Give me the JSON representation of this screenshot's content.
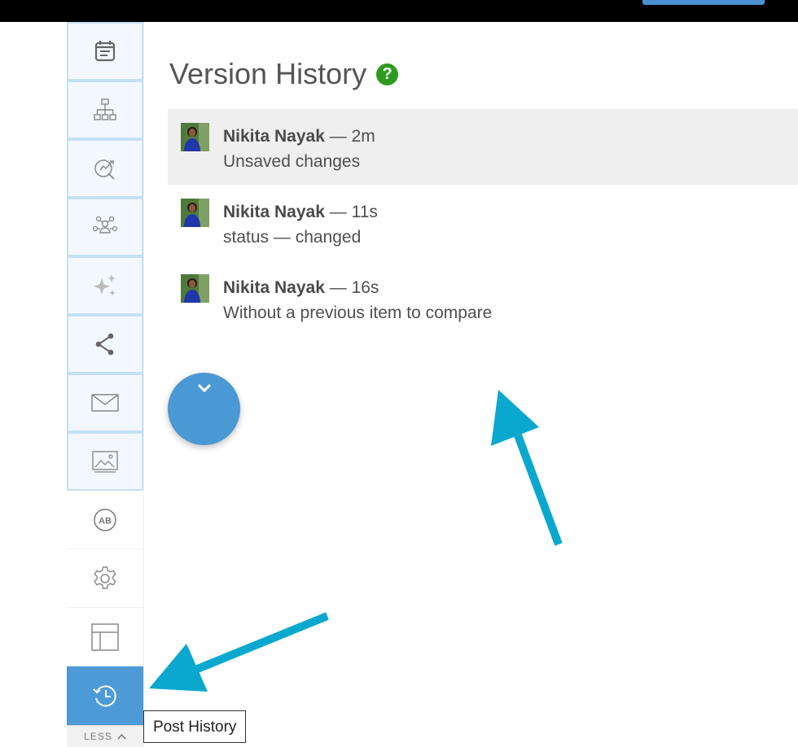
{
  "page": {
    "title": "Version History",
    "help_symbol": "?"
  },
  "versions": [
    {
      "author": "Nikita Nayak",
      "age": "2m",
      "description": "Unsaved changes",
      "selected": true
    },
    {
      "author": "Nikita Nayak",
      "age": "11s",
      "description": "status — changed",
      "selected": false
    },
    {
      "author": "Nikita Nayak",
      "age": "16s",
      "description": "Without a previous item to compare",
      "selected": false
    }
  ],
  "sidebar": {
    "items": [
      {
        "icon": "calendar-icon"
      },
      {
        "icon": "sitemap-icon"
      },
      {
        "icon": "target-icon"
      },
      {
        "icon": "people-network-icon"
      },
      {
        "icon": "sparkle-icon"
      },
      {
        "icon": "share-icon"
      },
      {
        "icon": "mail-icon"
      },
      {
        "icon": "image-icon"
      },
      {
        "icon": "ab-test-icon"
      },
      {
        "icon": "gear-icon"
      },
      {
        "icon": "layout-icon"
      },
      {
        "icon": "history-icon",
        "active": true
      }
    ],
    "less_label": "LESS"
  },
  "tooltip": "Post History",
  "colors": {
    "accent": "#4d9ad6",
    "help_green": "#2e9b1e",
    "annotation_arrow": "#0aa8cf",
    "selected_row": "#efefef"
  }
}
